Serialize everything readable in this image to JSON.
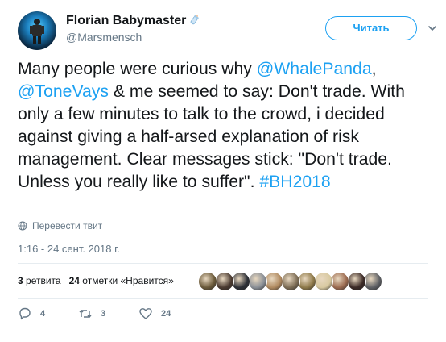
{
  "user": {
    "name": "Florian Babymaster",
    "handle": "@Marsmensch"
  },
  "follow_button": "Читать",
  "tweet": {
    "segments": [
      {
        "text": "Many people were curious why ",
        "type": "text"
      },
      {
        "text": "@WhalePanda",
        "type": "link"
      },
      {
        "text": ", ",
        "type": "text"
      },
      {
        "text": "@ToneVays",
        "type": "link"
      },
      {
        "text": " & me seemed to say: Don't trade. With only a few minutes to talk to the crowd, i decided against giving a half-arsed explanation of risk management. Clear messages stick: \"Don't trade. Unless you really like to suffer\". ",
        "type": "text"
      },
      {
        "text": "#BH2018",
        "type": "link"
      }
    ]
  },
  "translate_label": "Перевести твит",
  "timestamp": "1:16 - 24 сент. 2018 г.",
  "stats": {
    "retweets_count": "3",
    "retweets_label": "ретвита",
    "likes_count": "24",
    "likes_label": "отметки «Нравится»"
  },
  "likers": [
    {
      "color": "#6b5a3a"
    },
    {
      "color": "#4a3a30"
    },
    {
      "color": "#2c2f36"
    },
    {
      "color": "#8a8f96"
    },
    {
      "color": "#b08a60"
    },
    {
      "color": "#7d6d55"
    },
    {
      "color": "#8f7a4a"
    },
    {
      "color": "#d8c9a0"
    },
    {
      "color": "#9c6b50"
    },
    {
      "color": "#3b2a26"
    },
    {
      "color": "#5f6165"
    }
  ],
  "actions": {
    "reply_count": "4",
    "retweet_count": "3",
    "like_count": "24"
  },
  "colors": {
    "link": "#1da1f2",
    "secondary_text": "#657786",
    "divider": "#e6ecf0"
  }
}
